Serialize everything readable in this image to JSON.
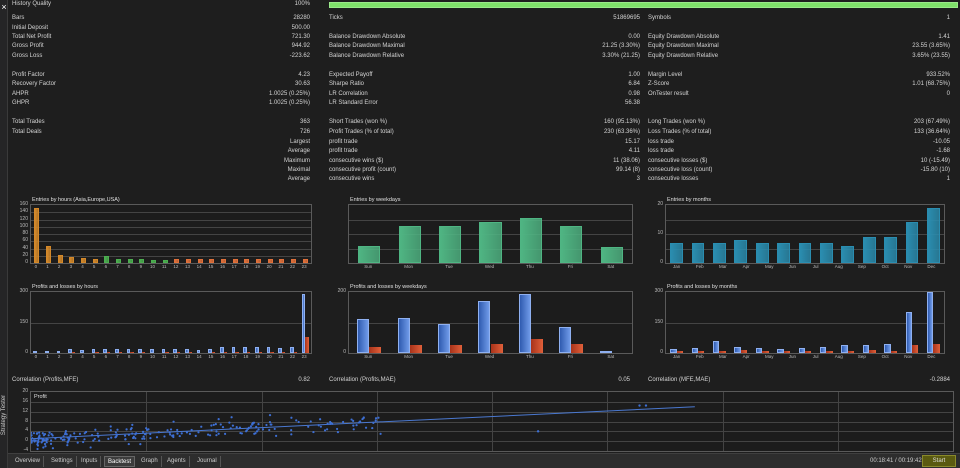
{
  "sidebar": {
    "close": "×",
    "vertical_label": "Strategy Tester"
  },
  "stats": {
    "history_quality": {
      "label": "History Quality",
      "value": "100%",
      "progress": 1.0
    },
    "bars": {
      "label": "Bars",
      "value": "28280"
    },
    "ticks": {
      "label": "Ticks",
      "value": "51869695"
    },
    "symbols": {
      "label": "Symbols",
      "value": "1"
    },
    "initial_deposit": {
      "label": "Initial Deposit",
      "value": "500.00"
    },
    "total_net_profit": {
      "label": "Total Net Profit",
      "value": "721.30"
    },
    "balance_dd_abs": {
      "label": "Balance Drawdown Absolute",
      "value": "0.00"
    },
    "equity_dd_abs": {
      "label": "Equity Drawdown Absolute",
      "value": "1.41"
    },
    "gross_profit": {
      "label": "Gross Profit",
      "value": "944.92"
    },
    "balance_dd_max": {
      "label": "Balance Drawdown Maximal",
      "value": "21.25 (3.30%)"
    },
    "equity_dd_max": {
      "label": "Equity Drawdown Maximal",
      "value": "23.55 (3.65%)"
    },
    "gross_loss": {
      "label": "Gross Loss",
      "value": "-223.62"
    },
    "balance_dd_rel": {
      "label": "Balance Drawdown Relative",
      "value": "3.30% (21.25)"
    },
    "equity_dd_rel": {
      "label": "Equity Drawdown Relative",
      "value": "3.65% (23.55)"
    },
    "profit_factor": {
      "label": "Profit Factor",
      "value": "4.23"
    },
    "expected_payoff": {
      "label": "Expected Payoff",
      "value": "1.00"
    },
    "margin_level": {
      "label": "Margin Level",
      "value": "933.52%"
    },
    "recovery_factor": {
      "label": "Recovery Factor",
      "value": "30.63"
    },
    "sharpe_ratio": {
      "label": "Sharpe Ratio",
      "value": "6.84"
    },
    "z_score": {
      "label": "Z-Score",
      "value": "1.01 (68.75%)"
    },
    "ahpr": {
      "label": "AHPR",
      "value": "1.0025 (0.25%)"
    },
    "lr_correlation": {
      "label": "LR Correlation",
      "value": "0.98"
    },
    "ontester": {
      "label": "OnTester result",
      "value": "0"
    },
    "ghpr": {
      "label": "GHPR",
      "value": "1.0025 (0.25%)"
    },
    "lr_std_error": {
      "label": "LR Standard Error",
      "value": "56.38"
    },
    "total_trades": {
      "label": "Total Trades",
      "value": "363"
    },
    "short_trades": {
      "label": "Short Trades (won %)",
      "value": "160 (95.13%)"
    },
    "long_trades": {
      "label": "Long Trades (won %)",
      "value": "203 (67.49%)"
    },
    "total_deals": {
      "label": "Total Deals",
      "value": "726"
    },
    "profit_trades": {
      "label": "Profit Trades (% of total)",
      "value": "230 (63.36%)"
    },
    "loss_trades": {
      "label": "Loss Trades (% of total)",
      "value": "133 (36.64%)"
    },
    "largest": {
      "label": "Largest",
      "profit_label": "profit trade",
      "profit": "15.17",
      "loss_label": "loss trade",
      "loss": "-10.05"
    },
    "average": {
      "label": "Average",
      "profit_label": "profit trade",
      "profit": "4.11",
      "loss_label": "loss trade",
      "loss": "-1.68"
    },
    "maximum": {
      "label": "Maximum",
      "profit_label": "consecutive wins ($)",
      "profit": "11 (38.06)",
      "loss_label": "consecutive losses ($)",
      "loss": "10 (-15.49)"
    },
    "maximal": {
      "label": "Maximal",
      "profit_label": "consecutive profit (count)",
      "profit": "99.14 (8)",
      "loss_label": "consecutive loss (count)",
      "loss": "-15.80 (10)"
    },
    "average2": {
      "label": "Average",
      "profit_label": "consecutive wins",
      "profit": "3",
      "loss_label": "consecutive losses",
      "loss": "1"
    }
  },
  "charts": {
    "hours_entries": {
      "title": "Entries by hours (Asia,Europe,USA)",
      "yticks": [
        "160",
        "140",
        "120",
        "100",
        "80",
        "60",
        "40",
        "20",
        "0"
      ],
      "ymax": 160,
      "categories": [
        "0",
        "1",
        "2",
        "3",
        "4",
        "5",
        "6",
        "7",
        "8",
        "9",
        "10",
        "11",
        "12",
        "13",
        "14",
        "15",
        "16",
        "17",
        "18",
        "19",
        "20",
        "21",
        "22",
        "23"
      ],
      "values": [
        152,
        48,
        22,
        16,
        14,
        12,
        20,
        12,
        10,
        10,
        8,
        8,
        10,
        12,
        10,
        10,
        10,
        12,
        12,
        10,
        10,
        10,
        10,
        10
      ],
      "colors": [
        "#d4892a",
        "#d4892a",
        "#d4892a",
        "#d4892a",
        "#d4892a",
        "#d4892a",
        "#4caf50",
        "#4caf50",
        "#4caf50",
        "#4caf50",
        "#4caf50",
        "#4caf50",
        "#e0703a",
        "#e0703a",
        "#e0703a",
        "#e0703a",
        "#e0703a",
        "#e0703a",
        "#e0703a",
        "#e0703a",
        "#e0703a",
        "#e0703a",
        "#e0703a",
        "#e0703a"
      ]
    },
    "weekday_entries": {
      "title": "Entries by weekdays",
      "ymax": 100,
      "categories": [
        "Sun",
        "Mon",
        "Tue",
        "Wed",
        "Thu",
        "Fri",
        "Sat"
      ],
      "values": [
        30,
        64,
        64,
        70,
        78,
        64,
        28
      ]
    },
    "month_entries": {
      "title": "Entries by months",
      "yticks": [
        "20",
        "10",
        "0"
      ],
      "ymax": 20,
      "categories": [
        "Jan",
        "Feb",
        "Mar",
        "Apr",
        "May",
        "Jun",
        "Jul",
        "Aug",
        "Sep",
        "Oct",
        "Nov",
        "Dec"
      ],
      "values": [
        7,
        7,
        7,
        8,
        7,
        7,
        7,
        7,
        6,
        9,
        9,
        14,
        19
      ]
    },
    "hours_pl": {
      "title": "Profits and losses by hours",
      "yticks": [
        "300",
        "150",
        "0"
      ],
      "ymax": 300,
      "categories": [
        "0",
        "1",
        "2",
        "3",
        "4",
        "5",
        "6",
        "7",
        "8",
        "9",
        "10",
        "11",
        "12",
        "13",
        "14",
        "15",
        "16",
        "17",
        "18",
        "19",
        "20",
        "21",
        "22",
        "23"
      ],
      "profits": [
        8,
        8,
        10,
        18,
        16,
        20,
        18,
        18,
        18,
        20,
        20,
        18,
        22,
        18,
        16,
        22,
        30,
        32,
        30,
        30,
        32,
        26,
        28,
        290
      ],
      "losses": [
        2,
        2,
        2,
        3,
        2,
        3,
        3,
        3,
        3,
        3,
        2,
        3,
        3,
        3,
        2,
        3,
        4,
        4,
        3,
        4,
        4,
        3,
        3,
        80
      ]
    },
    "weekday_pl": {
      "title": "Profits and losses by weekdays",
      "yticks": [
        "200",
        "0"
      ],
      "ymax": 200,
      "categories": [
        "Sun",
        "Mon",
        "Tue",
        "Wed",
        "Thu",
        "Fri",
        "Sat"
      ],
      "profits": [
        110,
        115,
        95,
        170,
        195,
        85,
        0
      ],
      "losses": [
        20,
        25,
        25,
        30,
        45,
        30,
        0
      ]
    },
    "month_pl": {
      "title": "Profits and losses by months",
      "yticks": [
        "300",
        "150",
        "0"
      ],
      "ymax": 300,
      "categories": [
        "Jan",
        "Feb",
        "Mar",
        "Apr",
        "May",
        "Jun",
        "Jul",
        "Aug",
        "Sep",
        "Oct",
        "Nov",
        "Dec"
      ],
      "profits": [
        20,
        25,
        60,
        30,
        25,
        20,
        25,
        30,
        40,
        40,
        45,
        200,
        300
      ],
      "losses": [
        8,
        10,
        12,
        15,
        10,
        10,
        10,
        12,
        12,
        15,
        10,
        40,
        45
      ]
    }
  },
  "correlations": {
    "pm": {
      "label": "Correlation (Profits,MFE)",
      "value": "0.82"
    },
    "pa": {
      "label": "Correlation (Profits,MAE)",
      "value": "0.05"
    },
    "ma": {
      "label": "Correlation (MFE,MAE)",
      "value": "-0.2884"
    }
  },
  "scatter": {
    "title": "Profit",
    "yticks": [
      "20",
      "16",
      "12",
      "8",
      "4",
      "0",
      "-4"
    ]
  },
  "tabs": [
    "Overview",
    "Settings",
    "Inputs",
    "Backtest",
    "Graph",
    "Agents",
    "Journal"
  ],
  "active_tab": "Backtest",
  "timer": "00:18:41 / 00:19:42",
  "start_label": "Start",
  "colors": {
    "accent_bar": "#7fe06a",
    "profit": "#4a78d0",
    "loss": "#d84a2a",
    "weekday_bar": "#4fb583",
    "month_bar": "#2a8db0"
  }
}
